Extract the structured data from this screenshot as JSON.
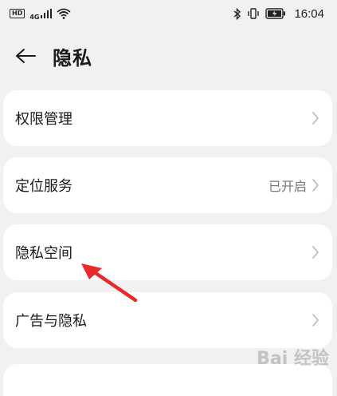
{
  "status_bar": {
    "hd": "HD",
    "network": "4G",
    "time": "16:04"
  },
  "header": {
    "title": "隐私"
  },
  "items": [
    {
      "label": "权限管理",
      "value": ""
    },
    {
      "label": "定位服务",
      "value": "已开启"
    },
    {
      "label": "隐私空间",
      "value": ""
    },
    {
      "label": "广告与隐私",
      "value": ""
    }
  ],
  "watermark": "Bai 经验",
  "colors": {
    "background": "#f1f1f1",
    "card": "#ffffff",
    "annotation_arrow": "#e82a2a"
  }
}
